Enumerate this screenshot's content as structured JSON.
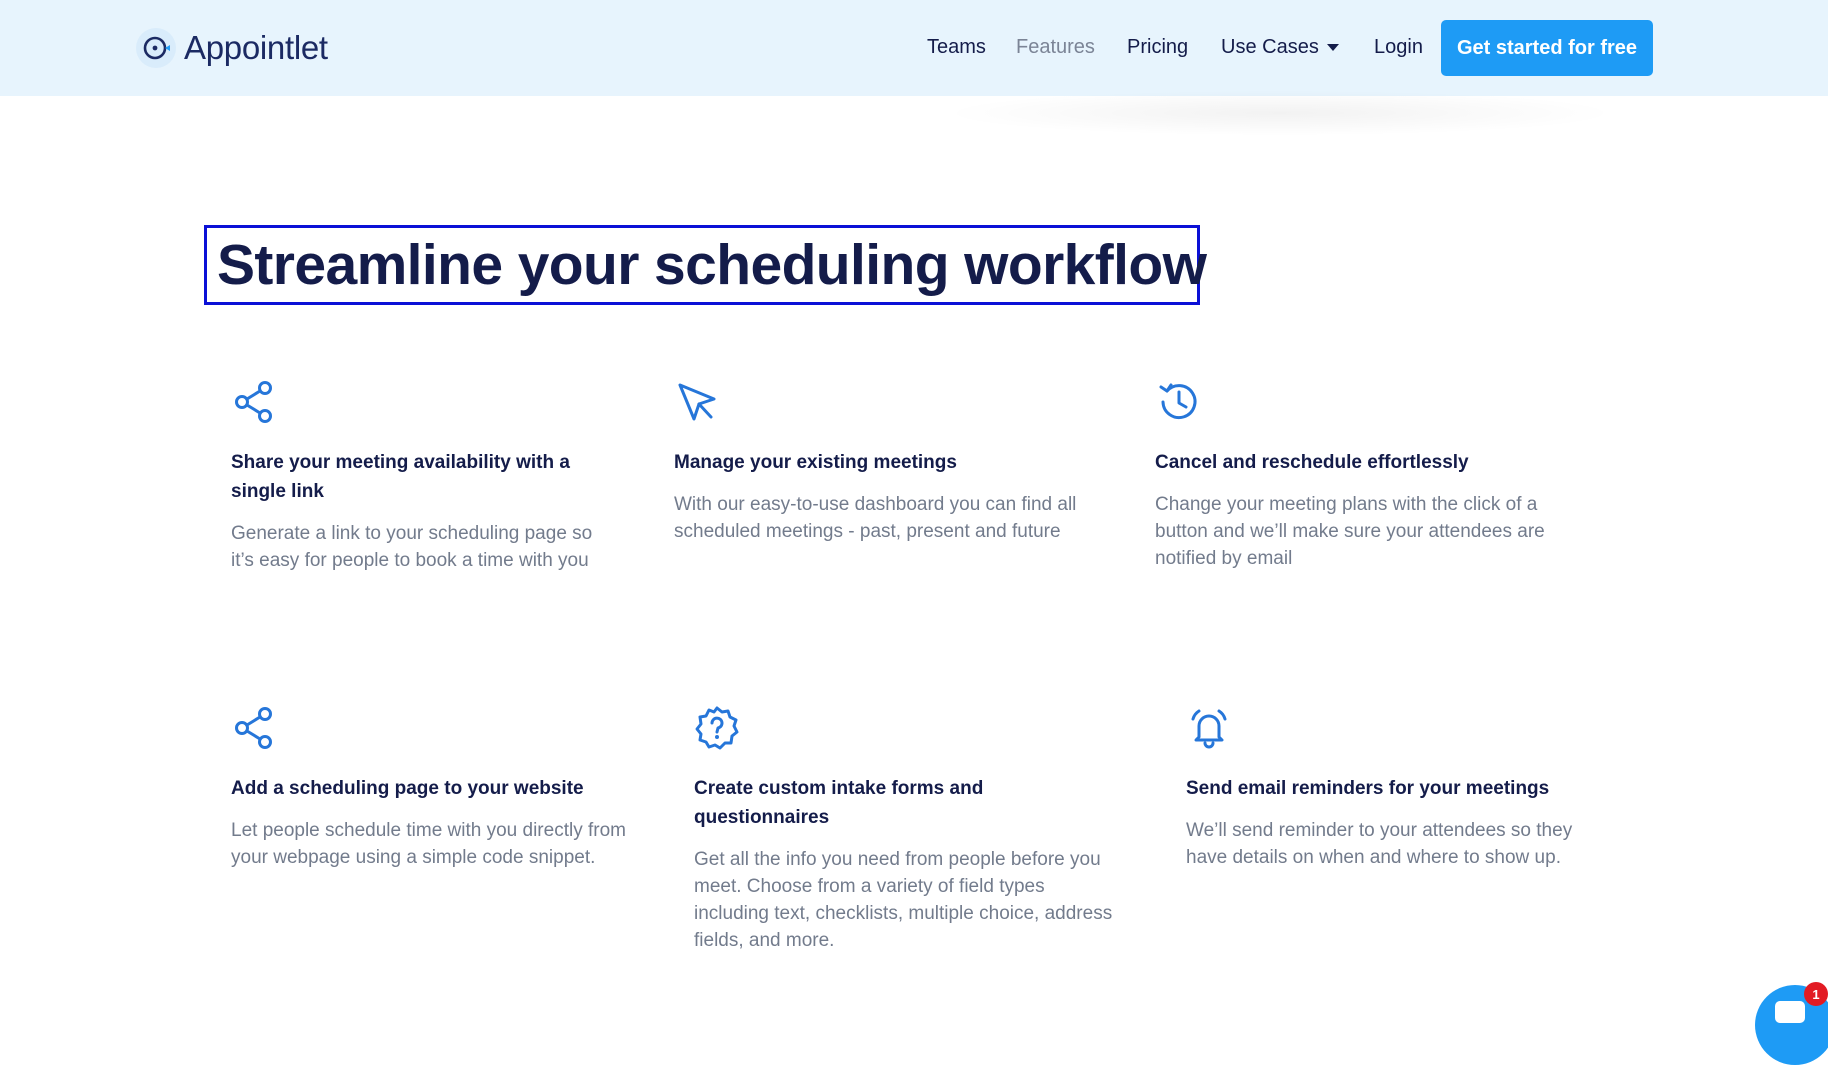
{
  "brand": {
    "name": "Appointlet",
    "accent": "#1e9bf5"
  },
  "nav": {
    "teams": "Teams",
    "features": "Features",
    "pricing": "Pricing",
    "use_cases": "Use Cases",
    "login": "Login",
    "cta": "Get started for free"
  },
  "hero": {
    "title": "Streamline your scheduling workflow"
  },
  "features": [
    {
      "icon": "share-icon",
      "title": "Share your meeting availability with a single link",
      "desc": "Generate a link to your scheduling page so it’s easy for people to book a time with you"
    },
    {
      "icon": "cursor-arrow-icon",
      "title": "Manage your existing meetings",
      "desc": "With our easy-to-use dashboard you can find all scheduled meetings - past, present and future"
    },
    {
      "icon": "history-clock-icon",
      "title": "Cancel and reschedule effortlessly",
      "desc": "Change your meeting plans with the click of a button and we’ll make sure your attendees are notified by email"
    },
    {
      "icon": "share-icon",
      "title": "Add a scheduling page to your website",
      "desc": "Let people schedule time with you directly from your webpage using a simple code snippet."
    },
    {
      "icon": "question-badge-icon",
      "title": "Create custom intake forms and questionnaires",
      "desc": "Get all the info you need from people before you meet. Choose from a variety of field types including text, checklists, multiple choice, address fields, and more."
    },
    {
      "icon": "bell-alarm-icon",
      "title": "Send email reminders for your meetings",
      "desc": "We’ll send reminder to your attendees so they have details on when and where to show up."
    }
  ],
  "chat": {
    "badge_count": "1"
  }
}
